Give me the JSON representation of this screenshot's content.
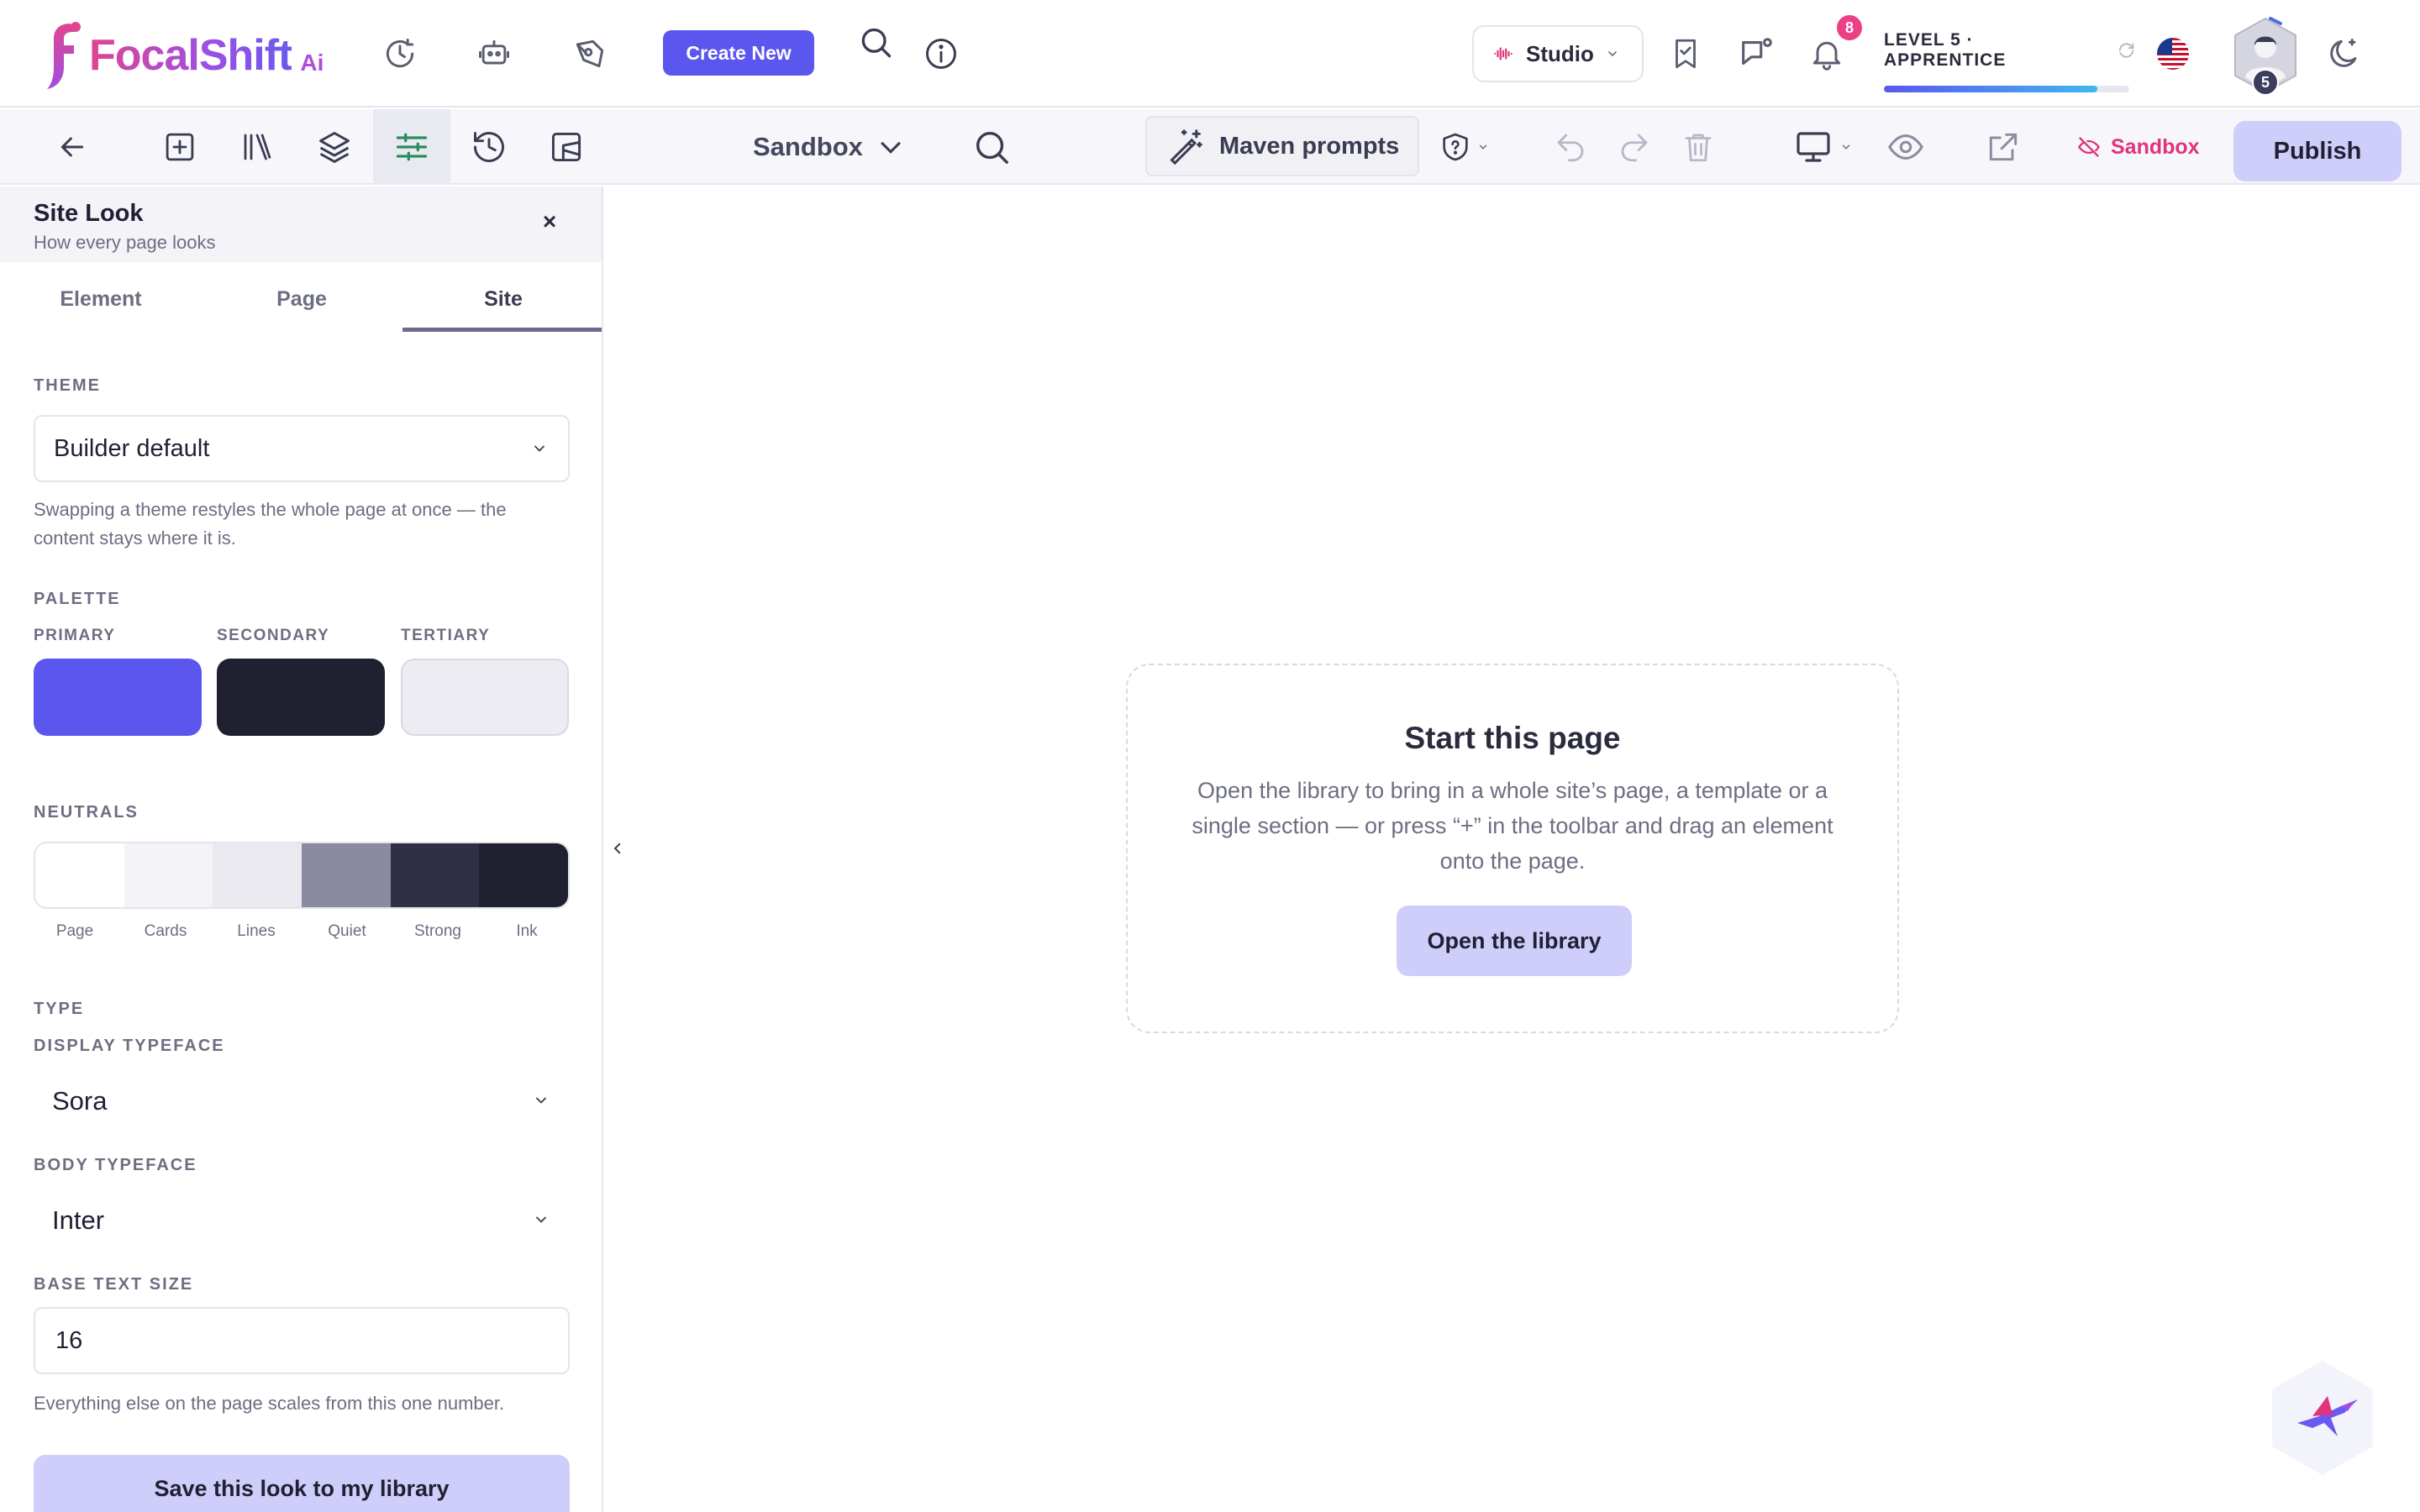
{
  "brand": {
    "name": "FocalShift",
    "suffix": "Ai"
  },
  "header": {
    "create_label": "Create New",
    "studio_label": "Studio",
    "notifications_count": "8",
    "level_label": "LEVEL 5 · APPRENTICE",
    "level_progress": 0.87,
    "avatar_level": "5"
  },
  "toolbar": {
    "page_selector": "Sandbox",
    "maven_label": "Maven prompts",
    "sandbox_tag": "Sandbox",
    "publish_label": "Publish"
  },
  "panel": {
    "title": "Site Look",
    "subtitle": "How every page looks",
    "close_glyph": "×",
    "tabs": [
      {
        "label": "Element"
      },
      {
        "label": "Page"
      },
      {
        "label": "Site"
      }
    ],
    "active_tab": "Site",
    "theme": {
      "label": "THEME",
      "value": "Builder default",
      "help": "Swapping a theme restyles the whole page at once — the content stays where it is."
    },
    "palette": {
      "label": "PALETTE",
      "swatches": [
        {
          "label": "PRIMARY",
          "color": "#5b57ee"
        },
        {
          "label": "SECONDARY",
          "color": "#1f2030"
        },
        {
          "label": "TERTIARY",
          "color": "#ececf2"
        }
      ]
    },
    "neutrals": {
      "label": "NEUTRALS",
      "items": [
        {
          "label": "Page",
          "color": "#ffffff"
        },
        {
          "label": "Cards",
          "color": "#f4f4f8"
        },
        {
          "label": "Lines",
          "color": "#e9e9ef"
        },
        {
          "label": "Quiet",
          "color": "#8a8aa0"
        },
        {
          "label": "Strong",
          "color": "#2f2f45"
        },
        {
          "label": "Ink",
          "color": "#1f2030"
        }
      ]
    },
    "type": {
      "label": "TYPE",
      "display_label": "DISPLAY TYPEFACE",
      "display_value": "Sora",
      "body_label": "BODY TYPEFACE",
      "body_value": "Inter",
      "base_size_label": "BASE TEXT SIZE",
      "base_size_value": "16",
      "base_size_help": "Everything else on the page scales from this one number."
    },
    "save_label": "Save this look to my library"
  },
  "canvas": {
    "empty_title": "Start this page",
    "empty_desc": "Open the library to bring in a whole site’s page, a template or a single section — or press “+” in the toolbar and drag an element onto the page.",
    "open_library_label": "Open the library"
  },
  "colors": {
    "accent": "#5b57ee",
    "accent_soft": "#cfcdfa",
    "pink": "#e0347c"
  }
}
